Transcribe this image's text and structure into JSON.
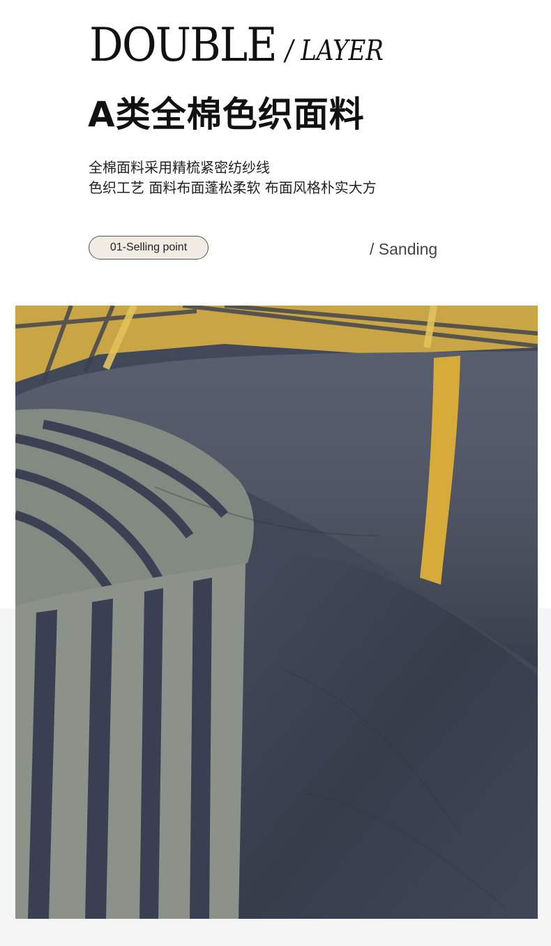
{
  "brand": {
    "main": "DOUBLE",
    "sub": "/ LAYER"
  },
  "headline": "A类全棉色织面料",
  "description": [
    "全棉面料采用精梳紧密纺纱线",
    "色织工艺 面料布面蓬松柔软 布面风格朴实大方"
  ],
  "selling_point": {
    "pill_label": "01-Selling point",
    "tag": "/ Sanding"
  },
  "photo": {
    "subject": "navy and yellow yarn-dyed plaid cotton fabric close-up",
    "colors": {
      "navy": "#3e4556",
      "gray_stripe": "#8b8f86",
      "yellow": "#d9ad3b"
    }
  }
}
